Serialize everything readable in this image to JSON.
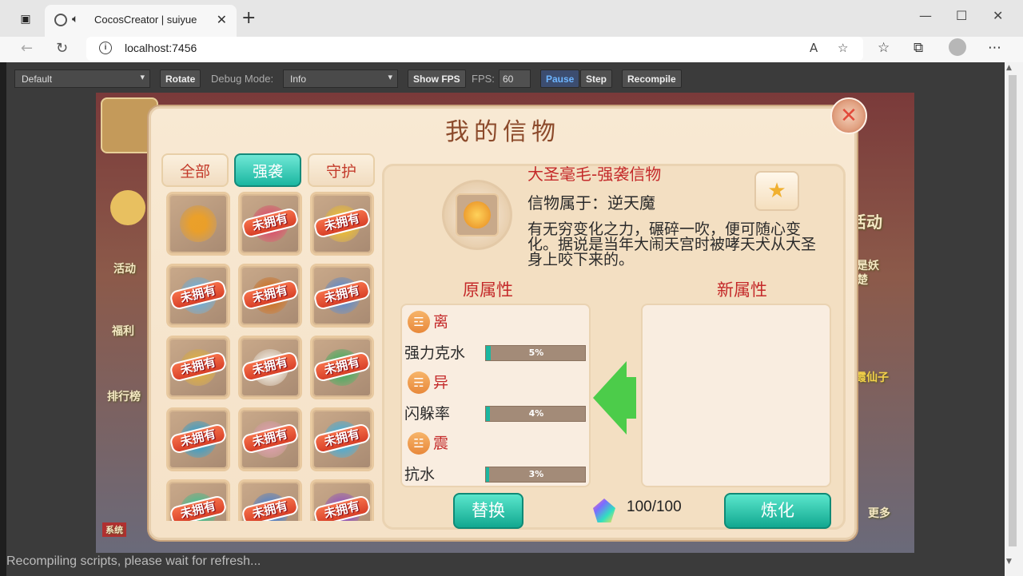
{
  "browser": {
    "tab_title": "CocosCreator | suiyue",
    "url": "localhost:7456"
  },
  "cocos_toolbar": {
    "device_select": "Default",
    "rotate_label": "Rotate",
    "debug_mode_label": "Debug Mode:",
    "debug_mode_value": "Info",
    "show_fps_label": "Show FPS",
    "fps_label": "FPS:",
    "fps_value": "60",
    "pause_label": "Pause",
    "step_label": "Step",
    "recompile_label": "Recompile"
  },
  "status_text": "Recompiling scripts, please wait for refresh...",
  "game_background": {
    "left_labels": [
      "活动",
      "福利",
      "排行榜"
    ],
    "right_labels": [
      "活动",
      "是妖",
      "楚",
      "霞仙子"
    ],
    "bottom_labels": [
      "系统",
      "更多"
    ]
  },
  "dialog": {
    "title": "我的信物",
    "tabs": [
      {
        "label": "全部",
        "active": false
      },
      {
        "label": "强袭",
        "active": true
      },
      {
        "label": "守护",
        "active": false
      }
    ],
    "not_owned_label": "未拥有",
    "items": [
      {
        "owned": true,
        "color": "#f0a020"
      },
      {
        "owned": false,
        "color": "#e04a6a"
      },
      {
        "owned": false,
        "color": "#f0c030"
      },
      {
        "owned": false,
        "color": "#6ab0e0"
      },
      {
        "owned": false,
        "color": "#d07020"
      },
      {
        "owned": false,
        "color": "#5a8ad0"
      },
      {
        "owned": false,
        "color": "#e0b040"
      },
      {
        "owned": false,
        "color": "#f4f0e8"
      },
      {
        "owned": false,
        "color": "#40b060"
      },
      {
        "owned": false,
        "color": "#30a0d0"
      },
      {
        "owned": false,
        "color": "#e0a0b0"
      },
      {
        "owned": false,
        "color": "#40b0e0"
      },
      {
        "owned": false,
        "color": "#40c090"
      },
      {
        "owned": false,
        "color": "#4a80d0"
      },
      {
        "owned": false,
        "color": "#9050c0"
      }
    ],
    "detail": {
      "item_name": "大圣毫毛-强袭信物",
      "owner": "信物属于：逆天魔",
      "description": "有无穷变化之力，碾碎一吹，便可随心变化。据说是当年大闹天宫时被哮天犬从大圣身上咬下来的。",
      "original_title": "原属性",
      "new_title": "新属性",
      "attributes": [
        {
          "trigram": "☲",
          "trigram_name": "离",
          "attr": "强力克水",
          "value": "5%",
          "fraction": 0.05
        },
        {
          "trigram": "☴",
          "trigram_name": "异",
          "attr": "闪躲率",
          "value": "4%",
          "fraction": 0.04
        },
        {
          "trigram": "☳",
          "trigram_name": "震",
          "attr": "抗水",
          "value": "3%",
          "fraction": 0.03
        }
      ],
      "replace_label": "替换",
      "refine_label": "炼化",
      "gem_count": "100/100"
    }
  },
  "colors": {
    "accent_teal": "#1bb6a0",
    "title_brown": "#8c4a2b",
    "red_text": "#c42a2a"
  }
}
